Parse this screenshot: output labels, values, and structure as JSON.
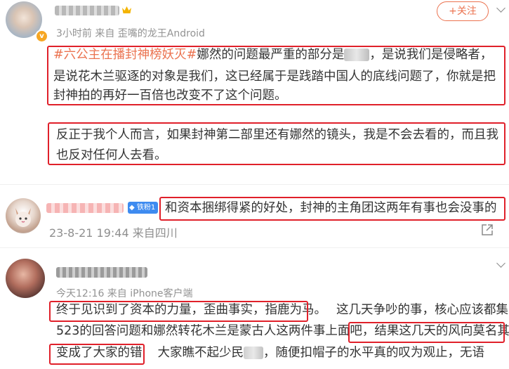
{
  "post1": {
    "follow_label": "+关注",
    "meta": "3小时前  来自 歪嘴的龙王Android",
    "topic": "#六公主在播封神榜妖灭#",
    "line1_rest": "娜然的问题最严重的部分是",
    "line1_end": "，是说我们是侵略者，",
    "line2": "是说花木兰驱逐的对象是我们，这已经属于是践踏中国人的底线问题了，你就是把",
    "line3": "封神拍的再好一百倍也改变不了这个问题。",
    "para2_line1": "反正于我个人而言，如果封神第二部里还有娜然的镜头，我是不会去看的，而且我",
    "para2_line2": "也反对任何人去看。"
  },
  "comment1": {
    "badge": "铁粉1",
    "text": "和资本捆绑得紧的好处，封神的主角团这两年有事也会没事的",
    "meta": "23-8-21 19:44 来自四川"
  },
  "post2": {
    "meta": "今天12:16  来自 iPhone客户端",
    "seg_a": "终于见识到了资本的力量，歪曲事实，指鹿为马。",
    "seg_b": "这几天争吵的事，核心应该都集中在",
    "line2_a": "523的回答问题和娜然转花木兰是蒙古人这两件事上面吧，",
    "line2_b": "结果这几天的风向莫名其妙",
    "line3_a": "变成了大家的错",
    "line3_b": "大家瞧不起少民",
    "line3_c": "，随便扣帽子的水平真的叹为观止，无语"
  },
  "colors": {
    "accent": "#eb7350",
    "highlight_box": "#e0202a",
    "verified": "#f6a623",
    "badge_blue": "#3e8bf0"
  }
}
